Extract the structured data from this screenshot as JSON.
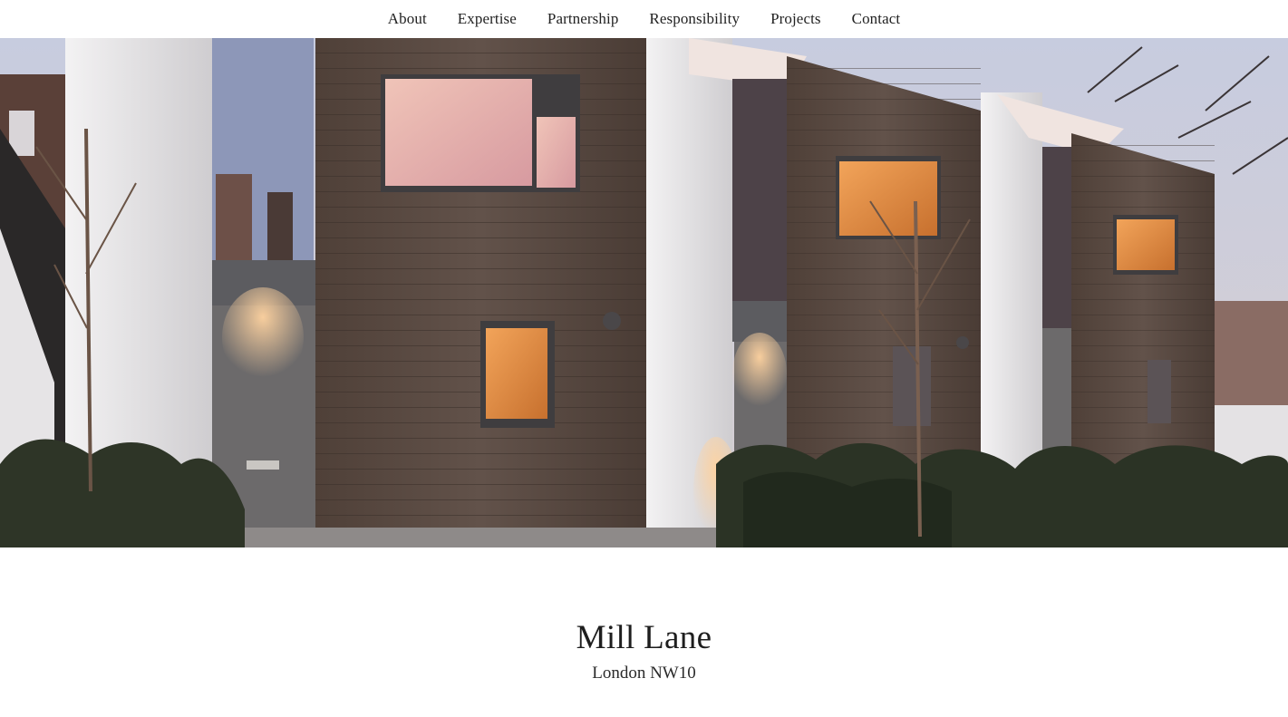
{
  "nav": {
    "items": [
      {
        "label": "About"
      },
      {
        "label": "Expertise"
      },
      {
        "label": "Partnership"
      },
      {
        "label": "Responsibility"
      },
      {
        "label": "Projects"
      },
      {
        "label": "Contact"
      }
    ]
  },
  "project": {
    "title": "Mill Lane",
    "location": "London NW10"
  },
  "colors": {
    "background": "#ffffff",
    "text": "#1e1e1e",
    "timber": "#5b4a40",
    "render_white": "#e8e6e6",
    "sky": "#c9cbd8",
    "window_glow": "#d98b4a"
  }
}
